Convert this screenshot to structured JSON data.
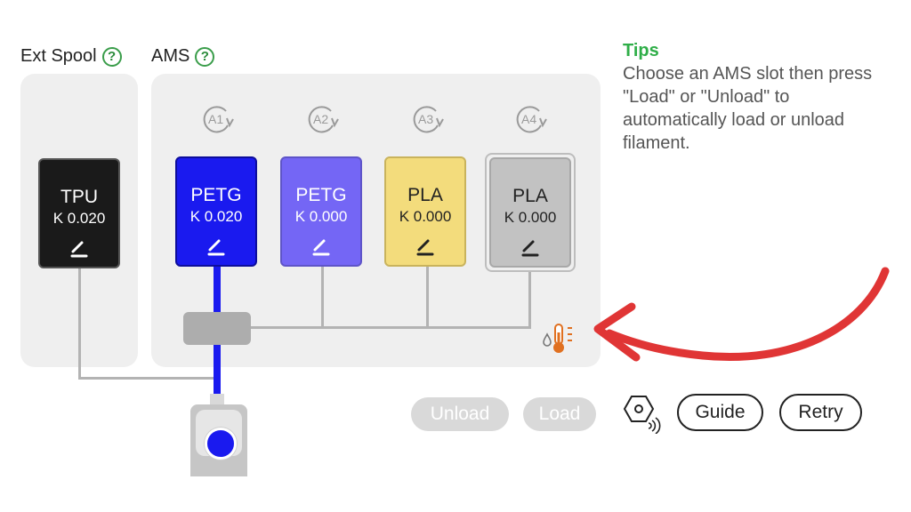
{
  "ext_spool": {
    "title": "Ext Spool",
    "help": "?",
    "spool": {
      "material": "TPU",
      "k_value": "K 0.020",
      "color": "#1a1a1a",
      "text_color": "#ffffff"
    }
  },
  "ams": {
    "title": "AMS",
    "help": "?",
    "slots": [
      {
        "label": "A1",
        "material": "PETG",
        "k_value": "K 0.020",
        "color": "#1a1aef",
        "text_color": "#ffffff",
        "selected": true
      },
      {
        "label": "A2",
        "material": "PETG",
        "k_value": "K 0.000",
        "color": "#7466f5",
        "text_color": "#ffffff",
        "selected": false
      },
      {
        "label": "A3",
        "material": "PLA",
        "k_value": "K 0.000",
        "color": "#f3dc7c",
        "text_color": "#222222",
        "selected": false
      },
      {
        "label": "A4",
        "material": "PLA",
        "k_value": "K 0.000",
        "color": "#c2c2c2",
        "text_color": "#222222",
        "selected": false
      }
    ],
    "humidity_icon": "humidity-temperature-icon"
  },
  "tips": {
    "title": "Tips",
    "text": "Choose an AMS slot then press \"Load\" or \"Unload\" to automatically load or unload filament."
  },
  "buttons": {
    "unload": "Unload",
    "load": "Load",
    "guide": "Guide",
    "retry": "Retry",
    "nozzle_icon": "nozzle-nfc-icon"
  },
  "colors": {
    "accent_green": "#2fae48",
    "annotation_arrow": "#e03535",
    "filament_path_active": "#1a1aef",
    "filament_path_idle": "#b3b3b3"
  }
}
